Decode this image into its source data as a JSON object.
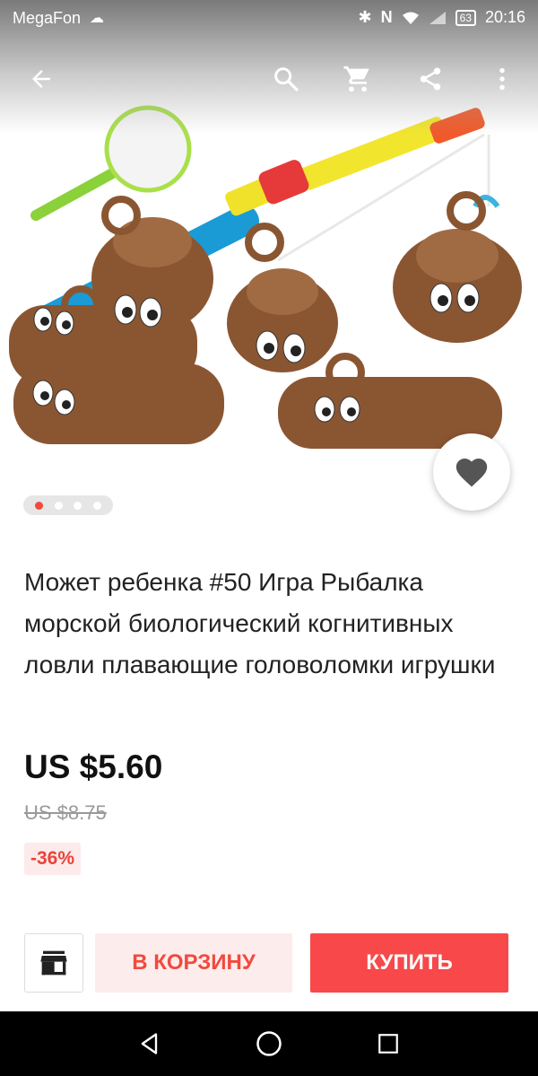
{
  "status_bar": {
    "carrier": "MegaFon",
    "battery": "63",
    "time": "20:16"
  },
  "toolbar": {
    "icons": [
      "back-arrow-icon",
      "search-icon",
      "cart-icon",
      "share-icon",
      "more-vert-icon"
    ]
  },
  "gallery": {
    "image_count": 4,
    "active_index": 0,
    "favorite_icon": "heart-icon"
  },
  "product": {
    "title": "Может ребенка #50 Игра Рыбалка морской биологический когнитивных ловли плавающие головоломки игрушки",
    "price": "US $5.60",
    "old_price": "US $8.75",
    "discount": "-36%"
  },
  "actions": {
    "store_icon": "store-icon",
    "add_to_cart": "В КОРЗИНУ",
    "buy": "КУПИТЬ"
  },
  "colors": {
    "accent": "#f8484a",
    "accent_light": "#fdecec",
    "active_dot": "#f04a3e"
  }
}
